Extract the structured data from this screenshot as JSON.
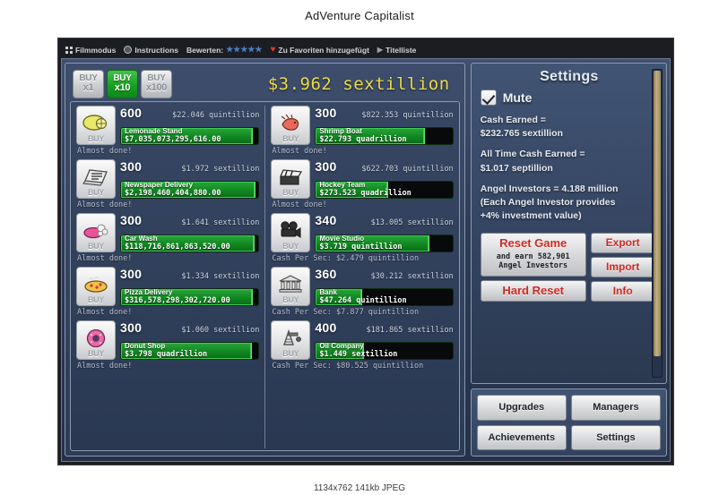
{
  "page": {
    "title": "AdVenture Capitalist",
    "caption": "1134x762  141kb  JPEG"
  },
  "toolbar": {
    "film_mode": "Filmmodus",
    "instructions": "Instructions",
    "rate_label": "Bewerten:",
    "stars": "★★★★★",
    "favorite": "Zu Favoriten hinzugefügt",
    "title_list": "Titelliste"
  },
  "game": {
    "cash_total": "$3.962 sextillion",
    "buy_multipliers": [
      {
        "top": "BUY",
        "bottom": "x1",
        "active": false
      },
      {
        "top": "BUY",
        "bottom": "x10",
        "active": true
      },
      {
        "top": "BUY",
        "bottom": "x100",
        "active": false
      }
    ],
    "businesses_left": [
      {
        "icon": "lemon-icon",
        "buy_label": "BUY",
        "count": "600",
        "cost": "$22.046 quintillion",
        "name": "Lemonade Stand",
        "value": "$7,035,073,295,616.00",
        "progress": 96,
        "status": "Almost done!"
      },
      {
        "icon": "newspaper-icon",
        "buy_label": "BUY",
        "count": "300",
        "cost": "$1.972 sextillion",
        "name": "Newspaper Delivery",
        "value": "$2,198,460,404,880.00",
        "progress": 98,
        "status": "Almost done!"
      },
      {
        "icon": "carwash-icon",
        "buy_label": "BUY",
        "count": "300",
        "cost": "$1.641 sextillion",
        "name": "Car Wash",
        "value": "$118,716,861,863,520.00",
        "progress": 97,
        "status": "Almost done!"
      },
      {
        "icon": "pizza-icon",
        "buy_label": "BUY",
        "count": "300",
        "cost": "$1.334 sextillion",
        "name": "Pizza Delivery",
        "value": "$316,578,298,302,720.00",
        "progress": 96,
        "status": "Almost done!"
      },
      {
        "icon": "donut-icon",
        "buy_label": "BUY",
        "count": "300",
        "cost": "$1.060 sextillion",
        "name": "Donut Shop",
        "value": "$3.798 quadrillion",
        "progress": 95,
        "status": "Almost done!"
      }
    ],
    "businesses_right": [
      {
        "icon": "shrimp-icon",
        "buy_label": "BUY",
        "count": "300",
        "cost": "$822.353 quintillion",
        "name": "Shrimp Boat",
        "value": "$22.793 quadrillion",
        "progress": 80,
        "status": "Almost done!"
      },
      {
        "icon": "clapperboard-icon",
        "buy_label": "BUY",
        "count": "300",
        "cost": "$622.703 quintillion",
        "name": "Hockey Team",
        "value": "$273.523 quadrillion",
        "progress": 53,
        "status": "Almost done!"
      },
      {
        "icon": "movie-camera-icon",
        "buy_label": "BUY",
        "count": "340",
        "cost": "$13.005 sextillion",
        "name": "Movie Studio",
        "value": "$3.719 quintillion",
        "progress": 83,
        "status": "Cash Per Sec: $2.479 quintillion"
      },
      {
        "icon": "bank-icon",
        "buy_label": "BUY",
        "count": "360",
        "cost": "$30.212 sextillion",
        "name": "Bank",
        "value": "$47.264 quintillion",
        "progress": 34,
        "status": "Cash Per Sec: $7.877 quintillion"
      },
      {
        "icon": "oil-derrick-icon",
        "buy_label": "BUY",
        "count": "400",
        "cost": "$181.865 sextillion",
        "name": "Oil Company",
        "value": "$1.449 sextillion",
        "progress": 35,
        "status": "Cash Per Sec: $80.525 quintillion"
      }
    ]
  },
  "settings": {
    "title": "Settings",
    "mute_label": "Mute",
    "mute_checked": true,
    "cash_earned_label": "Cash Earned =",
    "cash_earned_value": "$232.765 sextillion",
    "all_time_label": "All Time Cash Earned =",
    "all_time_value": "$1.017 septillion",
    "angel_investors": "Angel Investors = 4.188 million",
    "angel_note_1": "(Each Angel Investor provides",
    "angel_note_2": "+4% investment value)",
    "reset_game": "Reset Game",
    "reset_sub_1": "and earn 582,901",
    "reset_sub_2": "Angel Investors",
    "hard_reset": "Hard Reset",
    "export": "Export",
    "import": "Import",
    "info": "Info"
  },
  "menu": {
    "upgrades": "Upgrades",
    "managers": "Managers",
    "achievements": "Achievements",
    "settings": "Settings"
  },
  "colors": {
    "cash_yellow": "#ecd94a",
    "progress_green": "#17a021",
    "danger_red": "#cf2a24",
    "panel_blue": "#33435f",
    "scrollbar_gold": "#c4b184"
  }
}
